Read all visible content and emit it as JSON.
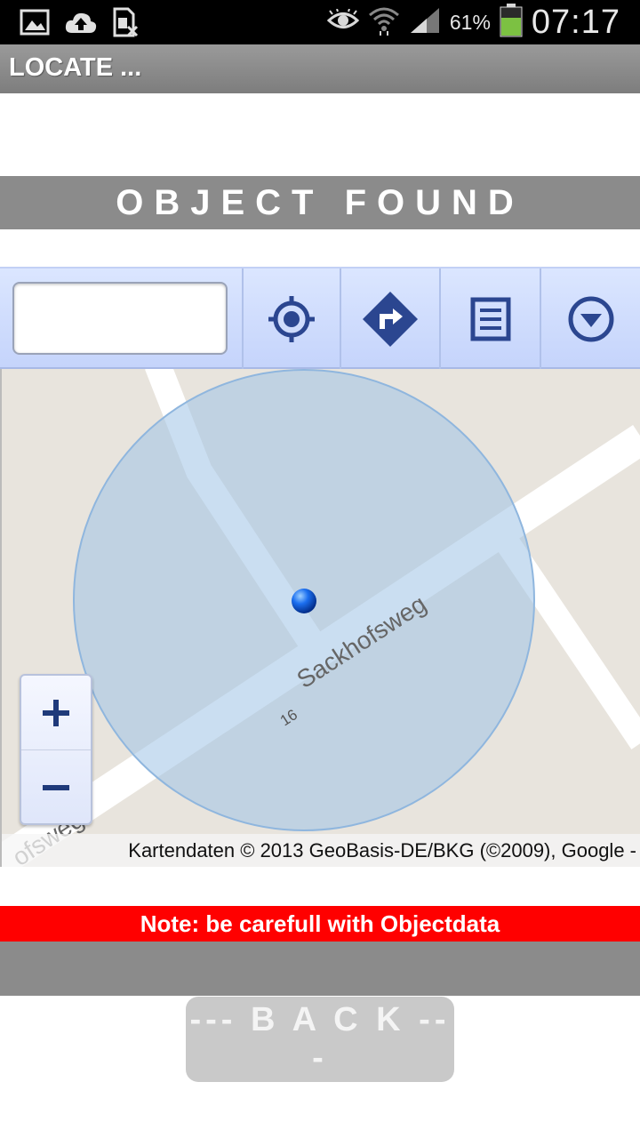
{
  "status_bar": {
    "icons_left": [
      "image-icon",
      "cloud-upload-icon",
      "sim-card-icon"
    ],
    "icons_right": [
      "eye-icon",
      "wifi-icon",
      "signal-icon",
      "battery-icon"
    ],
    "battery_percent": "61%",
    "battery_level": 0.61,
    "time": "07:17"
  },
  "titlebar": {
    "title": "LOCATE ..."
  },
  "banner": {
    "text": "OBJECT FOUND"
  },
  "toolbar": {
    "search_value": "",
    "buttons": [
      "locate-icon",
      "directions-icon",
      "list-icon",
      "dropdown-icon"
    ]
  },
  "map": {
    "street_name": "Sackhofsweg",
    "street_name_partial": "ofsweg",
    "house_number": "16",
    "attribution": "Kartendaten © 2013 GeoBasis-DE/BKG (©2009), Google -",
    "zoom_in_label": "+",
    "zoom_out_label": "−",
    "colors": {
      "road": "#ffffff",
      "land": "#e8e4dd",
      "accuracy_circle": "#9ec3e6",
      "marker": "#0a4fd6"
    }
  },
  "note": {
    "text": "Note: be carefull with Objectdata",
    "color": "#ff0000"
  },
  "back_button": {
    "label": "--- B A C K ---"
  }
}
